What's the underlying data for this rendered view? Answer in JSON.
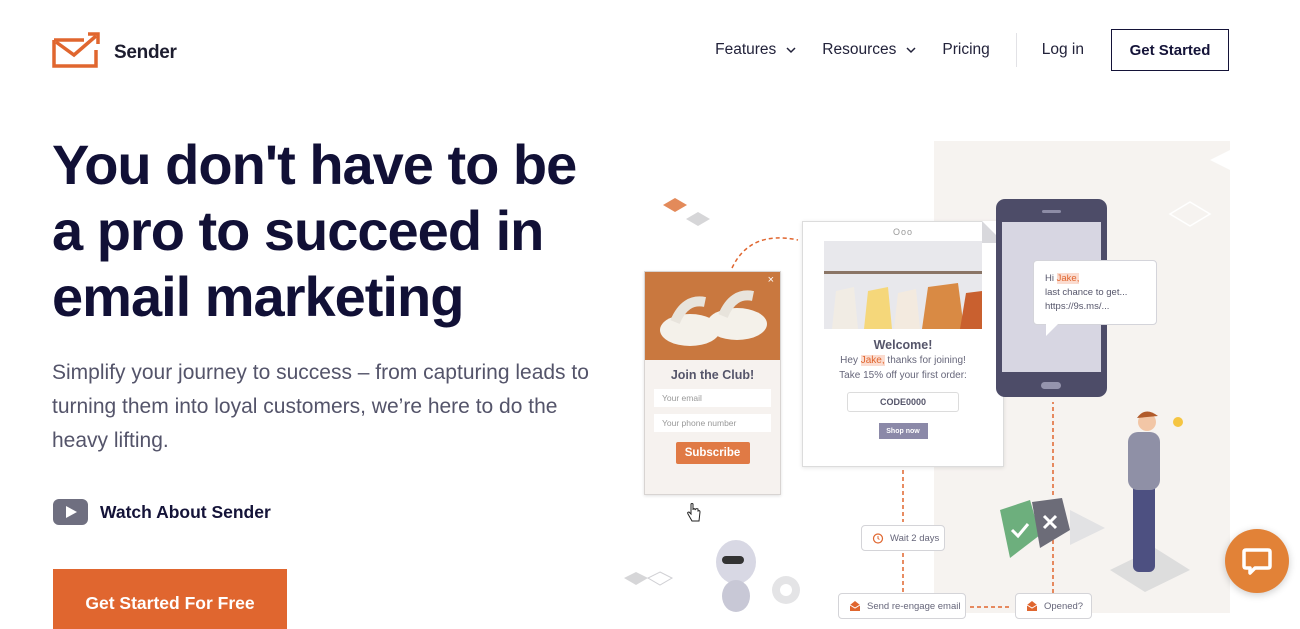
{
  "brand": {
    "name": "Sender",
    "accent": "#e0662f",
    "dark": "#141338"
  },
  "nav": {
    "items": [
      {
        "label": "Features",
        "has_dropdown": true
      },
      {
        "label": "Resources",
        "has_dropdown": true
      },
      {
        "label": "Pricing",
        "has_dropdown": false
      }
    ],
    "login": "Log in",
    "get_started": "Get Started"
  },
  "hero": {
    "title": "You don't have to be a pro to succeed in email marketing",
    "subtitle": "Simplify your journey to success – from capturing leads to turning them into loyal customers, we’re here to do the heavy lifting.",
    "watch_label": "Watch About Sender",
    "cta_label": "Get Started For Free"
  },
  "illustration": {
    "popup": {
      "close": "×",
      "title": "Join the Club!",
      "email_placeholder": "Your email",
      "phone_placeholder": "Your phone number",
      "button": "Subscribe"
    },
    "email": {
      "dots": "Ooo",
      "title": "Welcome!",
      "line1_prefix": "Hey ",
      "name": "Jake,",
      "line1_suffix": " thanks for joining!",
      "line2": "Take 15% off your first order:",
      "code": "CODE0000",
      "button": "Shop now"
    },
    "sms": {
      "greeting": "Hi ",
      "name": "Jake,",
      "line2": "last chance to get...",
      "line3": "https://9s.ms/..."
    },
    "flow": {
      "wait": "Wait 2 days",
      "send": "Send re-engage email",
      "opened": "Opened?"
    }
  },
  "chat": {
    "icon": "chat-icon"
  }
}
